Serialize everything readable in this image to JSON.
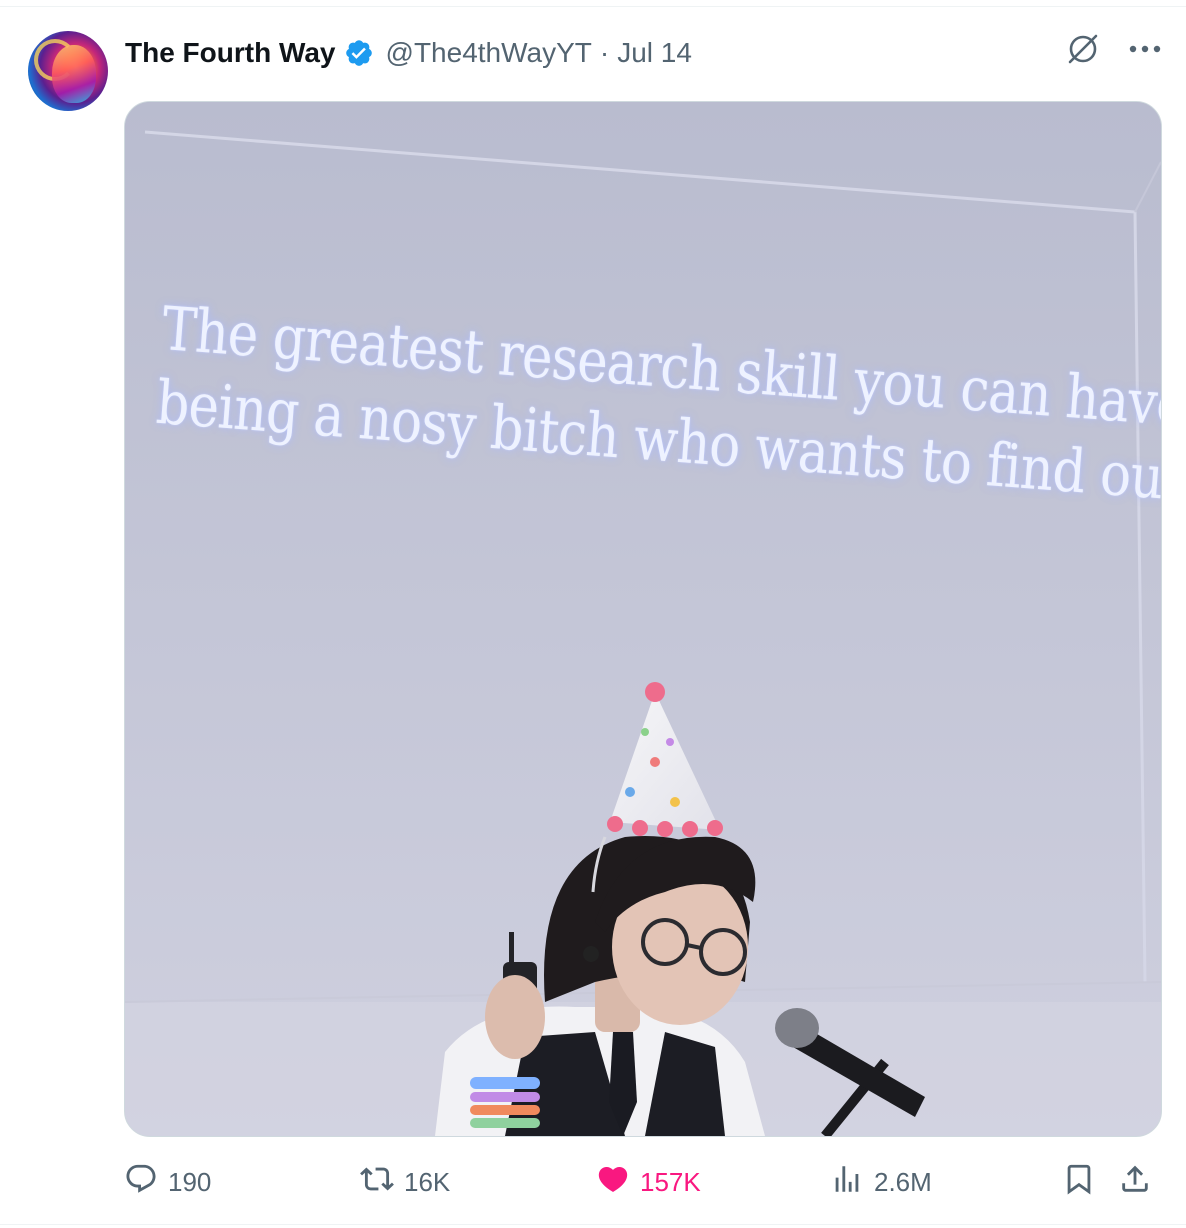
{
  "tweet": {
    "author": {
      "display_name": "The Fourth Way",
      "handle": "@The4thWayYT",
      "verified": true,
      "avatar_icon": "avatar-psychedelic-face"
    },
    "separator": "·",
    "date": "Jul 14",
    "header_icons": [
      "grok-icon",
      "more-icon"
    ],
    "media": {
      "type": "photo",
      "screen_text_lines": [
        "The greatest research skill you can have is",
        "being a nosy bitch who wants to find out"
      ]
    },
    "actions": {
      "replies": {
        "icon": "reply-icon",
        "count": "190"
      },
      "reposts": {
        "icon": "repost-icon",
        "count": "16K"
      },
      "likes": {
        "icon": "heart-icon",
        "count": "157K",
        "liked": true
      },
      "views": {
        "icon": "views-icon",
        "count": "2.6M"
      },
      "bookmark": {
        "icon": "bookmark-icon"
      },
      "share": {
        "icon": "share-icon"
      }
    },
    "colors": {
      "text": "#0f1419",
      "secondary": "#536471",
      "verified_blue": "#1d9bf0",
      "like_pink": "#f91880",
      "border": "#cfd9de"
    }
  }
}
